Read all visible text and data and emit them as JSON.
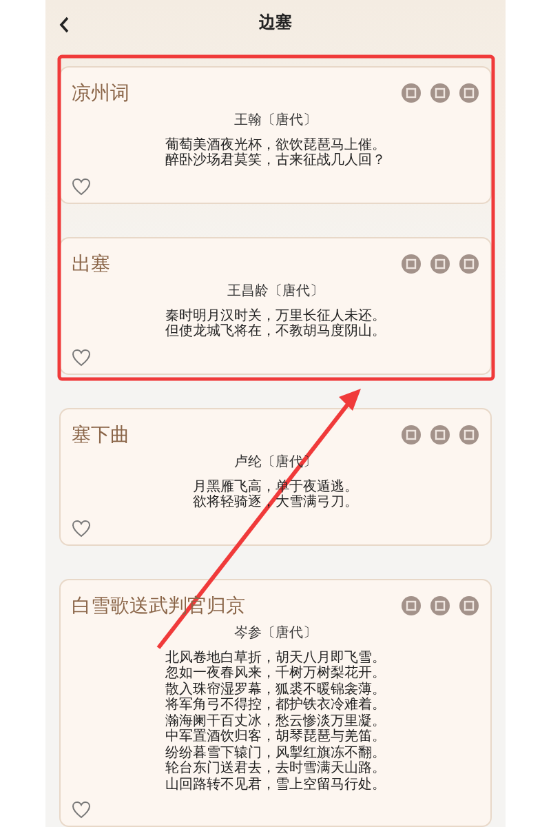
{
  "header": {
    "title": "边塞"
  },
  "poems": [
    {
      "title": "凉州词",
      "author": "王翰〔唐代〕",
      "lines": [
        "葡萄美酒夜光杯，欲饮琵琶马上催。",
        "醉卧沙场君莫笑，古来征战几人回？"
      ],
      "favorited": false
    },
    {
      "title": "出塞",
      "author": "王昌龄〔唐代〕",
      "lines": [
        "秦时明月汉时关，万里长征人未还。",
        "但使龙城飞将在，不教胡马度阴山。"
      ],
      "favorited": false
    },
    {
      "title": "塞下曲",
      "author": "卢纶〔唐代〕",
      "lines": [
        "月黑雁飞高，单于夜遁逃。",
        "欲将轻骑逐，大雪满弓刀。"
      ],
      "favorited": false
    },
    {
      "title": "白雪歌送武判官归京",
      "author": "岑参〔唐代〕",
      "lines": [
        "北风卷地白草折，胡天八月即飞雪。",
        "忽如一夜春风来，千树万树梨花开。",
        "散入珠帘湿罗幕，狐裘不暖锦衾薄。",
        "将军角弓不得控，都护铁衣冷难着。",
        "瀚海阑干百丈冰，愁云惨淡万里凝。",
        "中军置酒饮归客，胡琴琵琶与羌笛。",
        "纷纷暮雪下辕门，风掣红旗冻不翻。",
        "轮台东门送君去，去时雪满天山路。",
        "山回路转不见君，雪上空留马行处。"
      ],
      "favorited": false
    }
  ]
}
